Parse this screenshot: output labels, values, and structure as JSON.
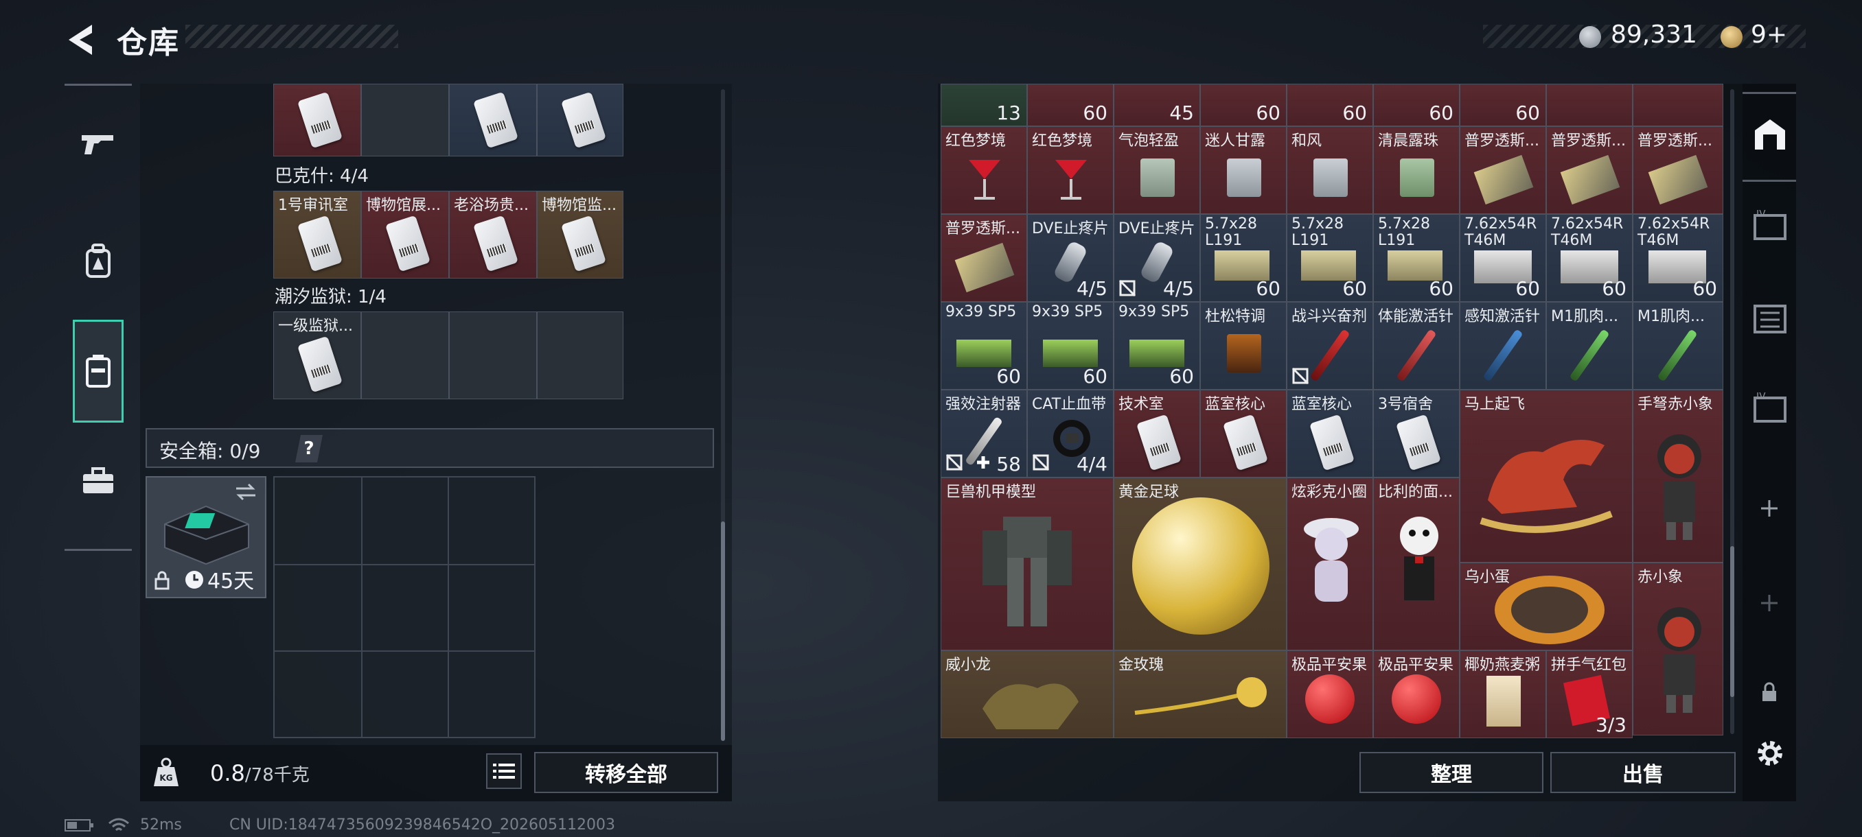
{
  "header": {
    "title": "仓库",
    "currency1_value": "89,331",
    "currency2_value": "9+"
  },
  "nav": {
    "items": [
      "gun-icon",
      "backpack-icon",
      "case-icon",
      "toolbox-icon"
    ],
    "active_index": 2
  },
  "left_panel": {
    "top_row_cells": [
      {
        "name": ""
      },
      {
        "name": ""
      },
      {
        "name": ""
      },
      {
        "name": ""
      }
    ],
    "groups": [
      {
        "label": "巴克什: 4/4",
        "cells": [
          "1号审讯室",
          "博物馆展...",
          "老浴场贵...",
          "博物馆监..."
        ]
      },
      {
        "label": "潮汐监狱: 1/4",
        "cells": [
          "一级监狱..."
        ]
      }
    ],
    "safe_box": {
      "label": "安全箱: 0/9",
      "help": "?",
      "duration": "45天"
    },
    "weight": {
      "value": "0.8",
      "max": "/78千克"
    },
    "transfer_all": "转移全部"
  },
  "right_panel": {
    "top_counts": [
      "13",
      "60",
      "45",
      "60",
      "60",
      "60",
      "60",
      ""
    ],
    "row1": [
      "红色梦境",
      "红色梦境",
      "气泡轻盈",
      "迷人甘露",
      "和风",
      "清晨露珠",
      "普罗透斯...",
      "普罗透斯...",
      "普罗透斯..."
    ],
    "row2": [
      {
        "name": "普罗透斯...",
        "count": ""
      },
      {
        "name": "DVE止疼片",
        "count": "4/5"
      },
      {
        "name": "DVE止疼片",
        "count": "4/5"
      },
      {
        "name": "5.7x28 L191",
        "count": "60"
      },
      {
        "name": "5.7x28 L191",
        "count": "60"
      },
      {
        "name": "5.7x28 L191",
        "count": "60"
      },
      {
        "name": "7.62x54R T46M",
        "count": "60"
      },
      {
        "name": "7.62x54R T46M",
        "count": "60"
      },
      {
        "name": "7.62x54R T46M",
        "count": "60"
      }
    ],
    "row3": [
      {
        "name": "9x39 SP5",
        "count": "60"
      },
      {
        "name": "9x39 SP5",
        "count": "60"
      },
      {
        "name": "9x39 SP5",
        "count": "60"
      },
      {
        "name": "杜松特调",
        "count": ""
      },
      {
        "name": "战斗兴奋剂",
        "count": ""
      },
      {
        "name": "体能激活针",
        "count": ""
      },
      {
        "name": "感知激活针",
        "count": ""
      },
      {
        "name": "M1肌肉...",
        "count": ""
      },
      {
        "name": "M1肌肉...",
        "count": ""
      }
    ],
    "row4": [
      {
        "name": "强效注射器",
        "count": "58"
      },
      {
        "name": "CAT止血带",
        "count": "4/4"
      },
      {
        "name": "技术室",
        "count": ""
      },
      {
        "name": "蓝室核心",
        "count": ""
      },
      {
        "name": "蓝室核心",
        "count": ""
      },
      {
        "name": "3号宿舍",
        "count": ""
      }
    ],
    "big_items": [
      {
        "name": "马上起飞"
      },
      {
        "name": "手弩赤小象"
      },
      {
        "name": "巨兽机甲模型"
      },
      {
        "name": "黄金足球"
      },
      {
        "name": "炫彩克小圈"
      },
      {
        "name": "比利的面..."
      },
      {
        "name": "乌小蛋"
      },
      {
        "name": "赤小象"
      },
      {
        "name": "威小龙"
      },
      {
        "name": "金玫瑰"
      },
      {
        "name": "极品平安果"
      },
      {
        "name": "极品平安果"
      },
      {
        "name": "椰奶燕麦粥"
      },
      {
        "name": "拼手气红包",
        "count": "3/3"
      }
    ],
    "sort_button": "整理",
    "sell_button": "出售"
  },
  "status_bar": {
    "ping": "52ms",
    "uid": "CN UID:18474735609239846542O_202605112003"
  },
  "colors": {
    "accent": "#3ecfb0",
    "item_red": "#5a2a30",
    "item_blue": "#2e3a4c",
    "item_gold": "#554432"
  }
}
